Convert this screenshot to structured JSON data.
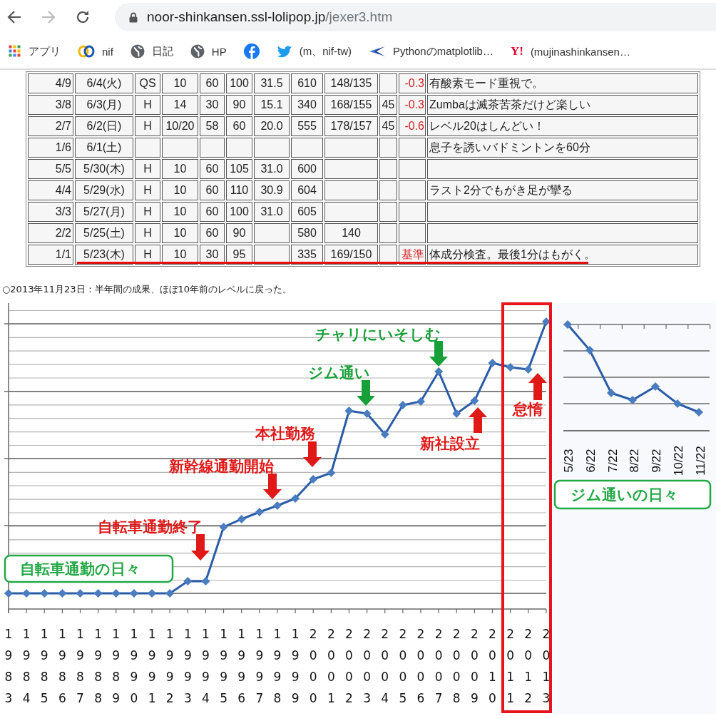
{
  "browser": {
    "back": {
      "disabled": false
    },
    "forward": {
      "disabled": true
    },
    "address": {
      "host": "noor-shinkansen.ssl-lolipop.jp",
      "path": "/jexer3.htm"
    },
    "bookmarks": [
      {
        "kind": "apps",
        "label": "アプリ"
      },
      {
        "kind": "rings",
        "label": "nif"
      },
      {
        "kind": "globe",
        "label": "日記"
      },
      {
        "kind": "globe",
        "label": "HP"
      },
      {
        "kind": "round"
      },
      {
        "kind": "bird",
        "label": "(m、nif-tw)"
      },
      {
        "kind": "swoosh",
        "label": "Pythonのmatplotlib…"
      },
      {
        "kind": "mark",
        "logo_text": "Y!",
        "label": "(mujinashinkansen…"
      }
    ]
  },
  "table": {
    "rows": [
      {
        "underlined": false,
        "cells": {
          "column_1": "4/9",
          "column_2": "6/4(火)",
          "column_3": "QS",
          "column_4": "10",
          "column_5": "60",
          "column_6": "100",
          "column_7": "31.5",
          "column_8": "610",
          "column_9": "148/135",
          "column_11": "-0.3",
          "column_12": "有酸素モード重視で。"
        }
      },
      {
        "underlined": false,
        "cells": {
          "column_1": "3/8",
          "column_2": "6/3(月)",
          "column_3": "H",
          "column_4": "14",
          "column_5": "30",
          "column_6": "90",
          "column_7": "15.1",
          "column_8": "340",
          "column_9": "168/155",
          "column_10": "45",
          "column_11": "-0.3",
          "column_12": "Zumbaは滅茶苦茶だけど楽しい"
        }
      },
      {
        "underlined": false,
        "cells": {
          "column_1": "2/7",
          "column_2": "6/2(日)",
          "column_3": "H",
          "column_4": "10/20",
          "column_5": "58",
          "column_6": "60",
          "column_7": "20.0",
          "column_8": "555",
          "column_9": "178/157",
          "column_10": "45",
          "column_11": "-0.6",
          "column_12": "レベル20はしんどい！"
        }
      },
      {
        "underlined": false,
        "cells": {
          "column_1": "1/6",
          "column_2": "6/1(土)",
          "column_12": "息子を誘いバドミントンを60分"
        }
      },
      {
        "underlined": false,
        "cells": {
          "column_1": "5/5",
          "column_2": "5/30(木)",
          "column_3": "H",
          "column_4": "10",
          "column_5": "60",
          "column_6": "105",
          "column_7": "31.0",
          "column_8": "600"
        }
      },
      {
        "underlined": false,
        "cells": {
          "column_1": "4/4",
          "column_2": "5/29(水)",
          "column_3": "H",
          "column_4": "10",
          "column_5": "60",
          "column_6": "110",
          "column_7": "30.9",
          "column_8": "604",
          "column_12": "ラスト2分でもがき足が攣る"
        }
      },
      {
        "underlined": false,
        "cells": {
          "column_1": "3/3",
          "column_2": "5/27(月)",
          "column_3": "H",
          "column_4": "10",
          "column_5": "60",
          "column_6": "100",
          "column_7": "31.0",
          "column_8": "605"
        }
      },
      {
        "underlined": false,
        "cells": {
          "column_1": "2/2",
          "column_2": "5/25(土)",
          "column_3": "H",
          "column_4": "10",
          "column_5": "60",
          "column_6": "90",
          "column_8": "580",
          "column_9": "140"
        }
      },
      {
        "underlined": true,
        "cells": {
          "column_1": "1/1",
          "column_2": "5/23(木)",
          "column_3": "H",
          "column_4": "10",
          "column_5": "30",
          "column_6": "95",
          "column_8": "335",
          "column_9": "169/150",
          "column_11": "基準",
          "column_12": "体成分検査。最後1分はもがく。"
        }
      }
    ]
  },
  "caption": "○2013年11月23日：半年間の成果、ほぼ10年前のレベルに戻った。",
  "chart": {
    "annotations": [
      {
        "text": "チャリにいそしむ",
        "color": "#18a038",
        "kind": "down"
      },
      {
        "text": "ジム通い",
        "color": "#18a038",
        "kind": "down"
      },
      {
        "text": "本社勤務",
        "color": "#e01818",
        "kind": "down"
      },
      {
        "text": "新幹線通勤開始",
        "color": "#e01818",
        "kind": "down"
      },
      {
        "text": "怠惰",
        "color": "#e01818",
        "kind": "up"
      },
      {
        "text": "新社設立",
        "color": "#e01818",
        "kind": "up"
      },
      {
        "text": "自転車通勤終了",
        "color": "#e01818",
        "kind": "down"
      }
    ],
    "period_labels": [
      "自転車通勤の日々",
      "ジム通いの日々"
    ],
    "year_labels": [
      "1983",
      "1984",
      "1985",
      "1986",
      "1987",
      "1988",
      "1989",
      "1990",
      "1991",
      "1992",
      "1993",
      "1994",
      "1995",
      "1996",
      "1997",
      "1998",
      "1999",
      "2000",
      "2001",
      "2002",
      "2003",
      "2004",
      "2005",
      "2006",
      "2007",
      "2008",
      "2009",
      "2010",
      "2011",
      "2012",
      "2013"
    ],
    "month_labels": [
      "5/23",
      "6/22",
      "7/22",
      "8/22",
      "9/22",
      "10/22",
      "11/22"
    ]
  }
}
